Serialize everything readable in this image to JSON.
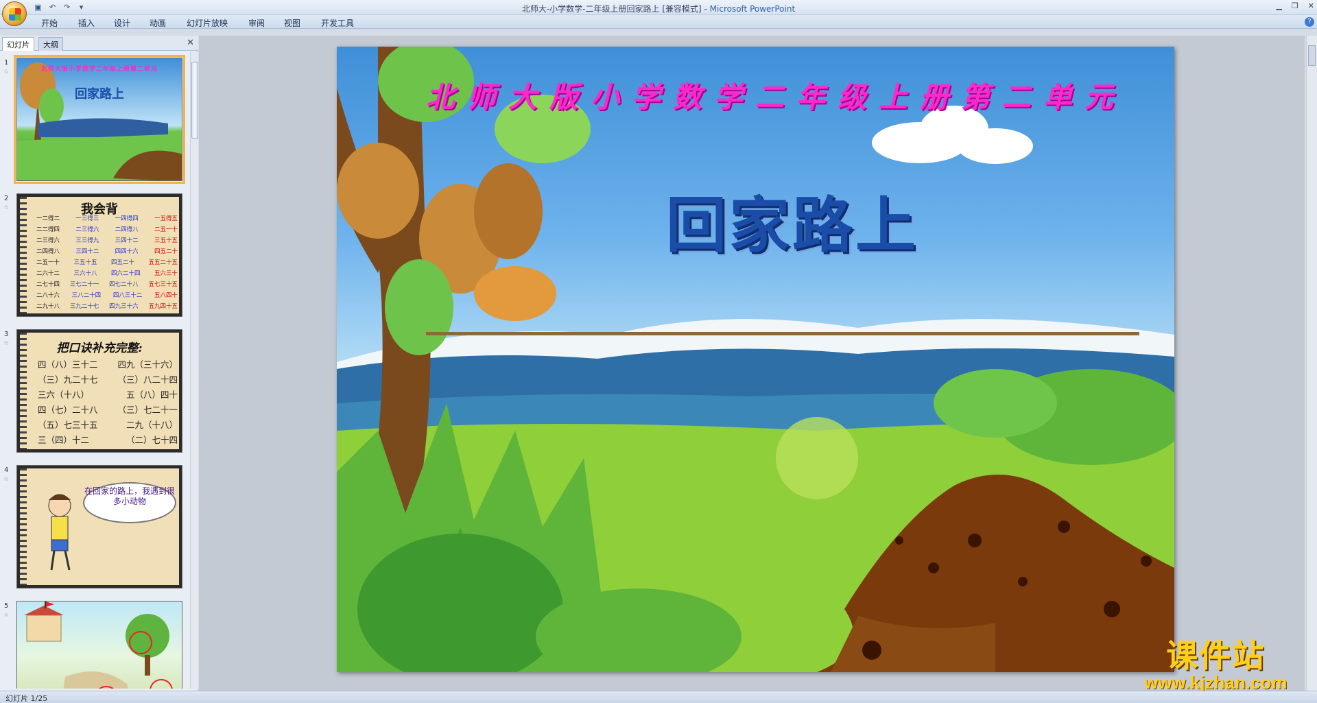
{
  "window": {
    "title": "北师大-小学数学-二年级上册回家路上 [兼容模式] - ",
    "app_name": "Microsoft PowerPoint"
  },
  "ribbon_tabs": [
    "开始",
    "插入",
    "设计",
    "动画",
    "幻灯片放映",
    "审阅",
    "视图",
    "开发工具"
  ],
  "pane": {
    "tabs": [
      "幻灯片",
      "大纲"
    ],
    "close": "✕",
    "thumbnails": [
      {
        "num": "1",
        "subtitle": "北师大版小学数学二年级上册第二单元",
        "title": "回家路上"
      },
      {
        "num": "2",
        "title": "我会背",
        "rows": [
          [
            "一二得二",
            "一三得三",
            "一四得四",
            "一五得五"
          ],
          [
            "二二得四",
            "二三得六",
            "二四得八",
            "二五一十"
          ],
          [
            "二三得六",
            "三三得九",
            "三四十二",
            "三五十五"
          ],
          [
            "二四得八",
            "三四十二",
            "四四十六",
            "四五二十"
          ],
          [
            "二五一十",
            "三五十五",
            "四五二十",
            "五五二十五"
          ],
          [
            "二六十二",
            "三六十八",
            "四六二十四",
            "五六三十"
          ],
          [
            "二七十四",
            "三七二十一",
            "四七二十八",
            "五七三十五"
          ],
          [
            "二八十六",
            "三八二十四",
            "四八三十二",
            "五八四十"
          ],
          [
            "二九十八",
            "三九二十七",
            "四九三十六",
            "五九四十五"
          ]
        ]
      },
      {
        "num": "3",
        "title": "把口诀补充完整:",
        "rows": [
          [
            "四（八）三十二",
            "四九（三十六）"
          ],
          [
            "（三）九二十七",
            "（三）八二十四"
          ],
          [
            "三六（十八）",
            "五（八）四十"
          ],
          [
            "四（七）二十八",
            "（三）七二十一"
          ],
          [
            "（五）七三十五",
            "二九（十八）"
          ],
          [
            "三（四）十二",
            "（二）七十四"
          ]
        ]
      },
      {
        "num": "4",
        "bubble": "在回家的路上，我遇到很多小动物"
      },
      {
        "num": "5"
      }
    ]
  },
  "slide": {
    "subtitle": "北师大版小学数学二年级上册第二单元",
    "title": "回家路上"
  },
  "watermark": {
    "cn": "课件站",
    "url": "www.kjzhan.com"
  },
  "status": {
    "slide_indicator": "幻灯片 1/25"
  }
}
